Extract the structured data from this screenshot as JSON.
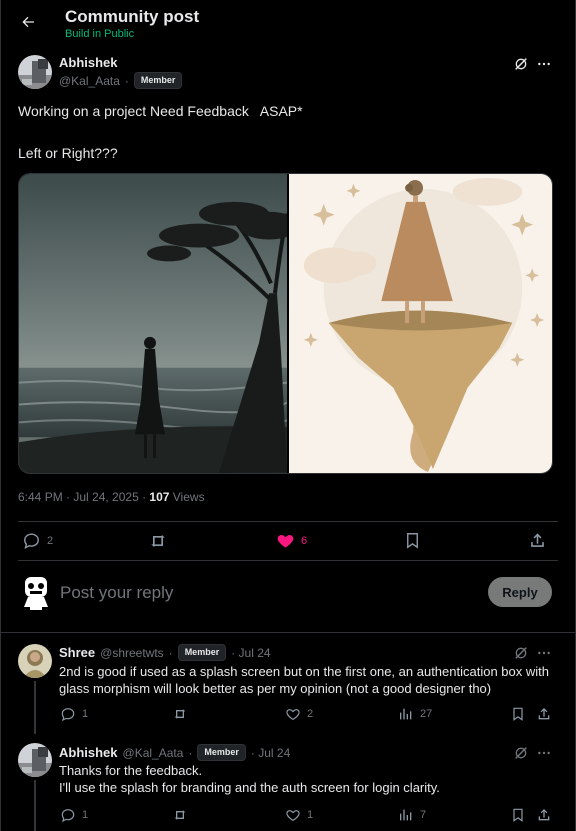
{
  "header": {
    "title": "Community post",
    "subtitle": "Build in Public"
  },
  "post": {
    "author_name": "Abhishek",
    "author_handle": "@Kal_Aata",
    "separator": "·",
    "badge": "Member",
    "text_line1": "Working on a project Need Feedback   ASAP*",
    "text_line2": "Left or Right???",
    "timestamp": "6:44 PM · Jul 24, 2025 · ",
    "views_count": "107",
    "views_label": " Views",
    "stats": {
      "replies": "2",
      "likes": "6"
    }
  },
  "composer": {
    "placeholder": "Post your reply",
    "reply_label": "Reply"
  },
  "replies": [
    {
      "name": "Shree",
      "handle": "@shreetwts",
      "separator": "·",
      "badge": "Member",
      "date": "· Jul 24",
      "text": "2nd is good if used as a splash screen but on the first one, an authentication box with glass morphism will look better as per my opinion (not a good designer tho)",
      "replies": "1",
      "likes": "2",
      "views": "27"
    },
    {
      "name": "Abhishek",
      "handle": "@Kal_Aata",
      "separator": "·",
      "badge": "Member",
      "date": "· Jul 24",
      "text_line1": "Thanks for the feedback.",
      "text_line2": "I'll use the splash for branding and the auth screen for login clarity.",
      "replies": "1",
      "likes": "1",
      "views": "7"
    }
  ],
  "colors": {
    "background": "#000000",
    "text": "#e7e9ea",
    "muted": "#71767b",
    "community_green": "#00ba7c",
    "like_pink": "#f91880",
    "divider": "#2f3336"
  },
  "icons": [
    "back-arrow-icon",
    "grok-icon",
    "more-icon",
    "reply-icon",
    "repost-icon",
    "heart-icon",
    "bookmark-icon",
    "share-icon",
    "views-icon"
  ]
}
